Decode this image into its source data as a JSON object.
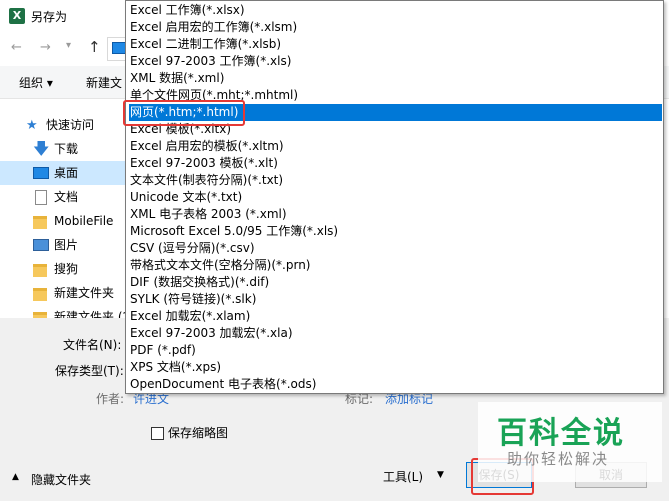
{
  "window": {
    "title": "另存为"
  },
  "commandbar": {
    "organize": "组织 ▾",
    "new_folder": "新建文"
  },
  "sidebar": {
    "items": [
      {
        "label": "快速访问"
      },
      {
        "label": "下载"
      },
      {
        "label": "桌面"
      },
      {
        "label": "文档"
      },
      {
        "label": "MobileFile"
      },
      {
        "label": "图片"
      },
      {
        "label": "搜狗"
      },
      {
        "label": "新建文件夹"
      },
      {
        "label": "新建文件夹 (2"
      }
    ]
  },
  "form": {
    "filename_label": "文件名(N):",
    "savetype_label": "保存类型(T):",
    "author_label": "作者:",
    "author_value": "许进文",
    "tags_label": "标记:",
    "tags_value": "添加标记",
    "thumbnail_label": "保存缩略图"
  },
  "footer": {
    "hide_folders": "隐藏文件夹",
    "tools": "工具(L)",
    "save": "保存(S)",
    "cancel": "取消"
  },
  "dropdown": {
    "selected_index": 6,
    "options": [
      "Excel 工作簿(*.xlsx)",
      "Excel 启用宏的工作簿(*.xlsm)",
      "Excel 二进制工作簿(*.xlsb)",
      "Excel 97-2003 工作簿(*.xls)",
      "XML 数据(*.xml)",
      "单个文件网页(*.mht;*.mhtml)",
      "网页(*.htm;*.html)",
      "Excel 模板(*.xltx)",
      "Excel 启用宏的模板(*.xltm)",
      "Excel 97-2003 模板(*.xlt)",
      "文本文件(制表符分隔)(*.txt)",
      "Unicode 文本(*.txt)",
      "XML 电子表格 2003 (*.xml)",
      "Microsoft Excel 5.0/95 工作簿(*.xls)",
      "CSV (逗号分隔)(*.csv)",
      "带格式文本文件(空格分隔)(*.prn)",
      "DIF (数据交换格式)(*.dif)",
      "SYLK (符号链接)(*.slk)",
      "Excel 加载宏(*.xlam)",
      "Excel 97-2003 加载宏(*.xla)",
      "PDF (*.pdf)",
      "XPS 文档(*.xps)",
      "OpenDocument 电子表格(*.ods)"
    ]
  },
  "watermark": {
    "title": "百科全说",
    "subtitle": "助你轻松解决"
  },
  "colors": {
    "accent": "#0078d7",
    "highlight_box": "#e53935",
    "brand": "#19a356"
  }
}
